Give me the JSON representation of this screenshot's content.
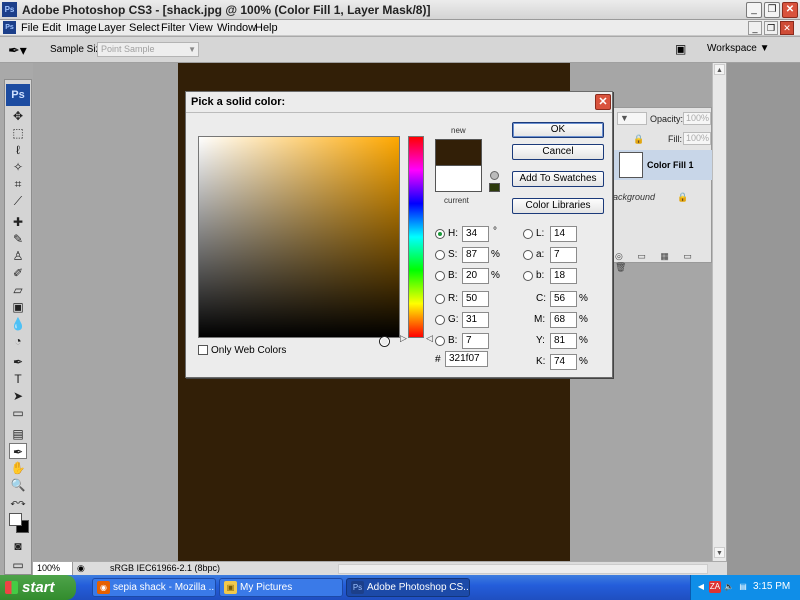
{
  "window": {
    "title": "Adobe Photoshop CS3 - [shack.jpg @ 100% (Color Fill 1, Layer Mask/8)]",
    "minimize": "_",
    "restore": "❐",
    "close": "✕"
  },
  "menu": {
    "items": [
      "File",
      "Edit",
      "Image",
      "Layer",
      "Select",
      "Filter",
      "View",
      "Window",
      "Help"
    ]
  },
  "options": {
    "sample_size_label": "Sample Size:",
    "sample_size_value": "Point Sample",
    "workspace_label": "Workspace ▼"
  },
  "toolbox": {
    "logo": "Ps"
  },
  "canvas": {
    "fill_color": "#321f07"
  },
  "layers": {
    "opacity_label": "Opacity:",
    "opacity_value": "100%",
    "fill_label": "Fill:",
    "fill_value": "100%",
    "layer_name": "Color Fill 1",
    "background_name": "ackground"
  },
  "status": {
    "zoom": "100%",
    "profile": "sRGB IEC61966-2.1 (8bpc)"
  },
  "dialog": {
    "title": "Pick a solid color:",
    "new_label": "new",
    "current_label": "current",
    "new_color": "#321f07",
    "current_color": "#ffffff",
    "buttons": {
      "ok": "OK",
      "cancel": "Cancel",
      "add_to_swatches": "Add To Swatches",
      "color_libraries": "Color Libraries"
    },
    "hsb": {
      "h_label": "H:",
      "h_value": "34",
      "h_unit": "°",
      "s_label": "S:",
      "s_value": "87",
      "s_unit": "%",
      "b_label": "B:",
      "b_value": "20",
      "b_unit": "%"
    },
    "rgb": {
      "r_label": "R:",
      "r_value": "50",
      "g_label": "G:",
      "g_value": "31",
      "b_label": "B:",
      "b_value": "7"
    },
    "lab": {
      "l_label": "L:",
      "l_value": "14",
      "a_label": "a:",
      "a_value": "7",
      "b_label": "b:",
      "b_value": "18"
    },
    "cmyk": {
      "c_label": "C:",
      "c_value": "56",
      "c_unit": "%",
      "m_label": "M:",
      "m_value": "68",
      "m_unit": "%",
      "y_label": "Y:",
      "y_value": "81",
      "y_unit": "%",
      "k_label": "K:",
      "k_value": "74",
      "k_unit": "%"
    },
    "hex_symbol": "#",
    "hex_value": "321f07",
    "only_web_colors": "Only Web Colors"
  },
  "taskbar": {
    "start": "start",
    "tasks": [
      {
        "label": "sepia shack - Mozilla ...",
        "icon": "firefox-icon"
      },
      {
        "label": "My Pictures",
        "icon": "folder-icon"
      },
      {
        "label": "Adobe Photoshop CS...",
        "icon": "photoshop-icon"
      }
    ],
    "clock": "3:15 PM"
  }
}
